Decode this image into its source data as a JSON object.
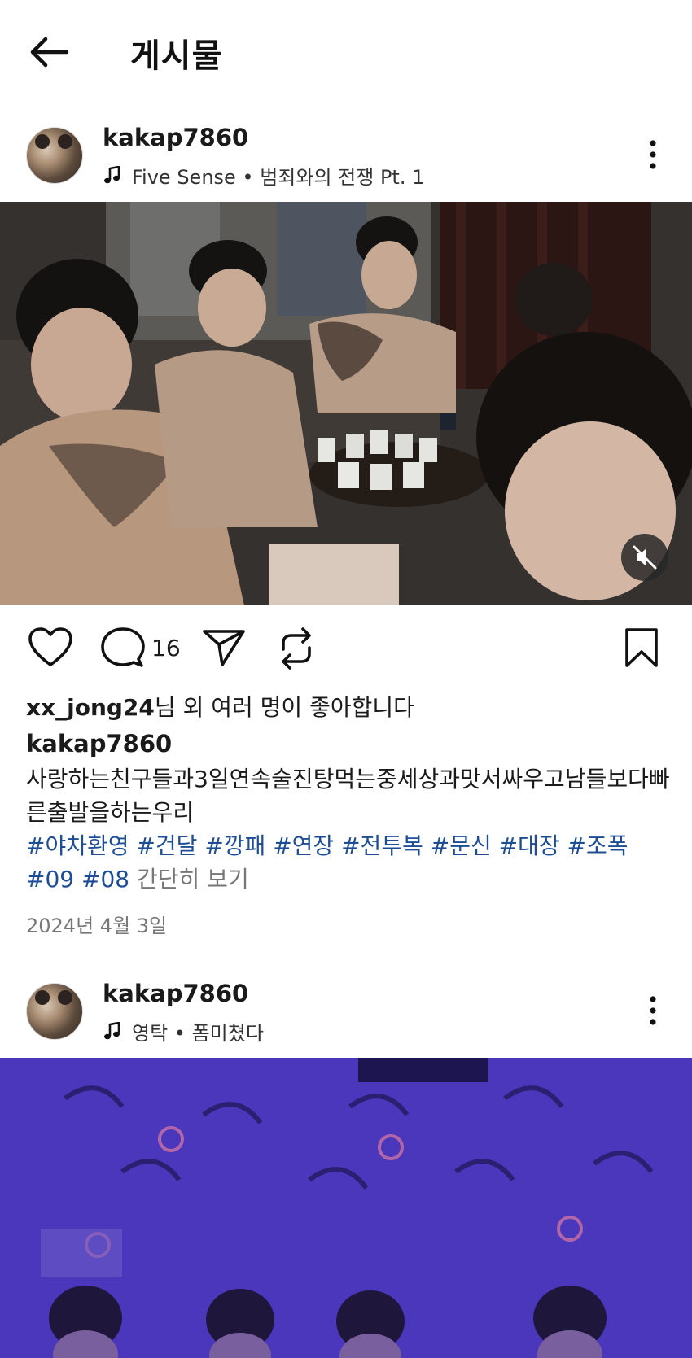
{
  "header": {
    "title": "게시물",
    "back_icon": "arrow-left-icon"
  },
  "posts": [
    {
      "username": "kakap7860",
      "music": "Five Sense • 범죄와의 전쟁 Pt. 1",
      "photo_description_colors": {
        "tone": "#2a2725"
      },
      "comment_count": "16",
      "likes_user": "xx_jong24",
      "likes_suffix": "님 외 여러 명이 좋아합니다",
      "caption_user": "kakap7860",
      "caption": "사랑하는친구들과3일연속술진탕먹는중세상과맛서싸우고남들보다빠른출발을하는우리",
      "tags": [
        "#야차환영",
        "#건달",
        "#깡패",
        "#연장",
        "#전투복",
        "#문신",
        "#대장",
        "#조폭",
        "#09",
        "#08"
      ],
      "more_label": "간단히 보기",
      "date": "2024년 4월 3일"
    },
    {
      "username": "kakap7860",
      "music": "영탁 • 폼미쳤다",
      "photo_description_colors": {
        "tone": "#4a35b6"
      }
    }
  ],
  "icons": {
    "like": "heart-icon",
    "comment": "comment-icon",
    "share": "send-icon",
    "remix": "repost-icon",
    "save": "bookmark-icon",
    "more": "more-vertical-icon",
    "music": "music-note-icon",
    "mute": "speaker-muted-icon"
  },
  "colors": {
    "hashtag": "#1e4d95",
    "secondary_text": "#777777"
  }
}
